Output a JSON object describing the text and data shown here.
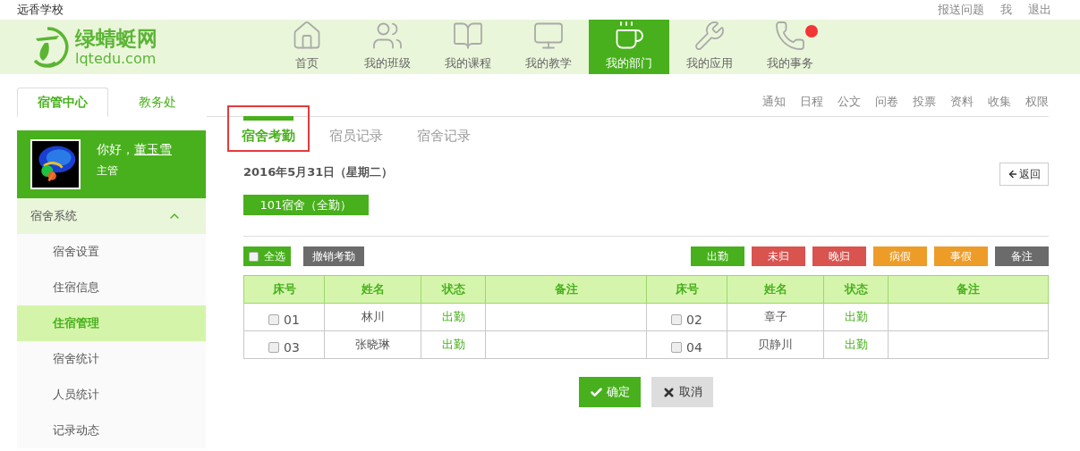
{
  "school": "远香学校",
  "top_links": [
    "报送问题",
    "我",
    "退出"
  ],
  "logo": {
    "name": "绿蜻蜓网",
    "domain": "lqtedu.com"
  },
  "nav": [
    {
      "label": "首页",
      "selected": false,
      "notification": false
    },
    {
      "label": "我的班级",
      "selected": false,
      "notification": false
    },
    {
      "label": "我的课程",
      "selected": false,
      "notification": false
    },
    {
      "label": "我的教学",
      "selected": false,
      "notification": false
    },
    {
      "label": "我的部门",
      "selected": true,
      "notification": false
    },
    {
      "label": "我的应用",
      "selected": false,
      "notification": false
    },
    {
      "label": "我的事务",
      "selected": false,
      "notification": true
    }
  ],
  "section_tabs": [
    {
      "label": "宿管中心",
      "selected": true
    },
    {
      "label": "教务处",
      "selected": false
    }
  ],
  "section_links": [
    "通知",
    "日程",
    "公文",
    "问卷",
    "投票",
    "资料",
    "收集",
    "权限"
  ],
  "profile": {
    "greeting": "你好，",
    "name": "董玉雪",
    "role": "主管"
  },
  "sidebar": {
    "group": {
      "label": "宿舍系统",
      "expanded": true
    },
    "items": [
      {
        "label": "宿舍设置",
        "selected": false
      },
      {
        "label": "住宿信息",
        "selected": false
      },
      {
        "label": "住宿管理",
        "selected": true
      },
      {
        "label": "宿舍统计",
        "selected": false
      },
      {
        "label": "人员统计",
        "selected": false
      },
      {
        "label": "记录动态",
        "selected": false
      }
    ]
  },
  "subtabs": [
    {
      "label": "宿舍考勤",
      "selected": true,
      "highlighted": true
    },
    {
      "label": "宿员记录",
      "selected": false,
      "highlighted": false
    },
    {
      "label": "宿舍记录",
      "selected": false,
      "highlighted": false
    }
  ],
  "date": "2016年5月31日（星期二）",
  "back_button": "返回",
  "dorm_button": "101宿舍（全勤）",
  "select_all": {
    "label": "全选",
    "checked": false
  },
  "revoke_button": "撤销考勤",
  "status_buttons": [
    {
      "label": "出勤",
      "color": "#48b01c"
    },
    {
      "label": "未归",
      "color": "#d9534f"
    },
    {
      "label": "晚归",
      "color": "#d9534f"
    },
    {
      "label": "病假",
      "color": "#ed9c28"
    },
    {
      "label": "事假",
      "color": "#ed9c28"
    },
    {
      "label": "备注",
      "color": "#6b6b6b"
    }
  ],
  "table": {
    "columns": [
      "床号",
      "姓名",
      "状态",
      "备注",
      "床号",
      "姓名",
      "状态",
      "备注"
    ],
    "rows": [
      {
        "beds": [
          {
            "bed": "01",
            "checked": false,
            "name": "林川",
            "status": "出勤"
          },
          {
            "bed": "02",
            "checked": false,
            "name": "章子",
            "status": "出勤"
          }
        ]
      },
      {
        "beds": [
          {
            "bed": "03",
            "checked": false,
            "name": "张晓琳",
            "status": "出勤"
          },
          {
            "bed": "04",
            "checked": false,
            "name": "贝静川",
            "status": "出勤"
          }
        ]
      }
    ]
  },
  "confirm_button": "确定",
  "cancel_button": "取消"
}
